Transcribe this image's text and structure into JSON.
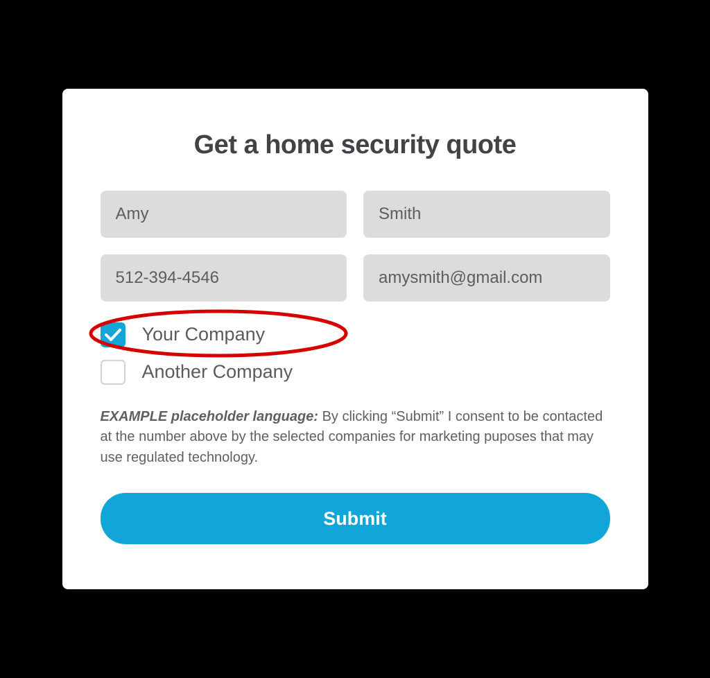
{
  "form": {
    "title": "Get a home security quote",
    "first_name": "Amy",
    "last_name": "Smith",
    "phone": "512-394-4546",
    "email": "amysmith@gmail.com",
    "options": [
      {
        "label": "Your Company",
        "checked": true
      },
      {
        "label": "Another Company",
        "checked": false
      }
    ],
    "disclaimer_lead": "EXAMPLE placeholder language:",
    "disclaimer_rest": " By clicking “Submit” I consent to be contacted at the number above by the selected companies for marketing puposes that may use regulated technology.",
    "submit_label": "Submit"
  },
  "colors": {
    "accent": "#12a6d8",
    "annotator": "#d60000"
  }
}
